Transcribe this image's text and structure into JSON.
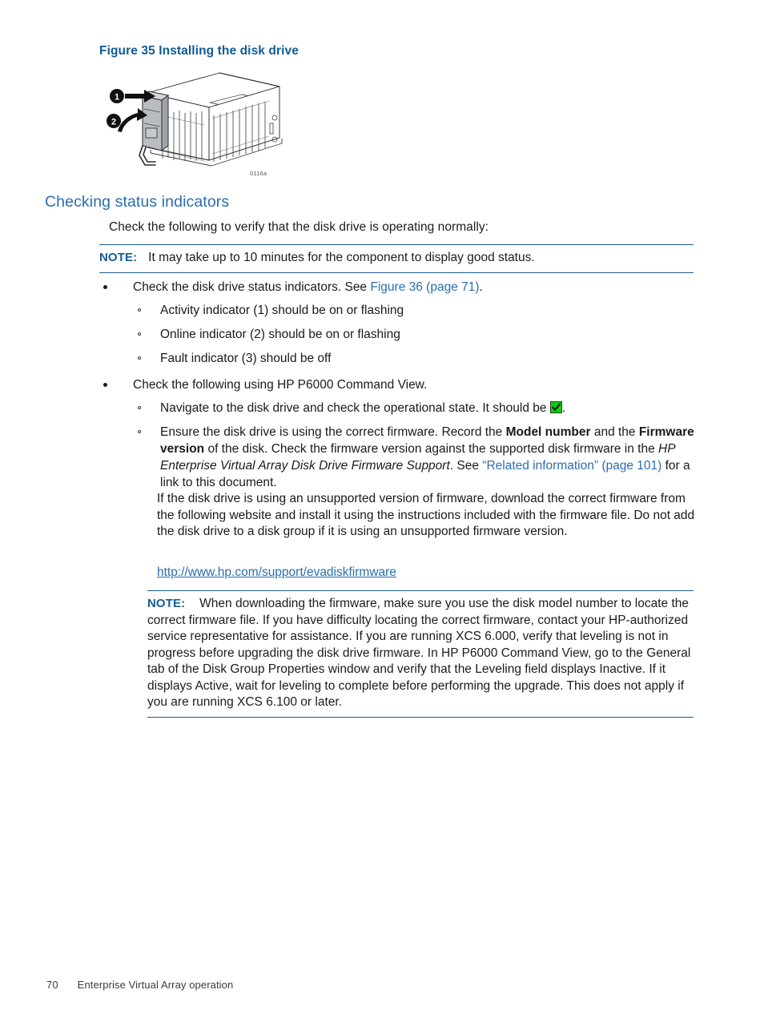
{
  "document": {
    "figure": {
      "title": "Figure 35 Installing the disk drive",
      "image_id": "0116a",
      "callouts": [
        "1",
        "2"
      ],
      "alt": "Isometric line drawing of a disk enclosure with a disk drive being inserted into the leftmost bay; arrow 1 points the drive into the bay, arrow 2 shows the latch handle rotating closed."
    },
    "section": {
      "heading": "Checking status indicators",
      "lead_paragraph": "Check the following to verify that the disk drive is operating normally:"
    },
    "note_1": {
      "label": "NOTE:",
      "text": "It may take up to 10 minutes for the component to display good status."
    },
    "bullets": [
      {
        "text_before_link": "Check the disk drive status indicators. See ",
        "link": "Figure 36 (page 71)",
        "text_after_link": ".",
        "sub_items": [
          "Activity indicator (1) should be on or flashing",
          "Online indicator (2) should be on or flashing",
          "Fault indicator (3) should be off"
        ]
      },
      {
        "text": "Check the following using HP P6000 Command View.",
        "sub_items": [
          "Navigate to the disk drive and check the operational state. It should be "
        ]
      }
    ],
    "check_icon": {
      "name": "green-check-status-icon",
      "color": "#00d400",
      "trailing_text": "."
    },
    "firmware_item": {
      "part1": "Ensure the disk drive is using the correct firmware. Record the ",
      "bold1": "Model number",
      "part2": " and the ",
      "bold2": "Firmware version",
      "part3": " of the disk. Check the firmware version against the supported disk firmware in the ",
      "italic1": "HP Enterprise Virtual Array Disk Drive Firmware Support",
      "part4": ". See ",
      "link1": "“Related information” (page 101)",
      "part5": " for a link to this document."
    },
    "unsupported_firmware_para": "If the disk drive is using an unsupported version of firmware, download the correct firmware from the following website and install it using the instructions included with the firmware file. Do not add the disk drive to a disk group if it is using an unsupported firmware version.",
    "url": "http://www.hp.com/support/evadiskfirmware",
    "note_2": {
      "label": "NOTE:",
      "text": "When downloading the firmware, make sure you use the disk model number to locate the correct firmware file. If you have difficulty locating the correct firmware, contact your HP-authorized service representative for assistance. If you are running XCS 6.000, verify that leveling is not in progress before upgrading the disk drive firmware. In HP P6000 Command View, go to the General tab of the Disk Group Properties window and verify that the Leveling field displays Inactive. If it displays Active, wait for leveling to complete before performing the upgrade. This does not apply if you are running XCS 6.100 or later."
    },
    "footer": {
      "page_number": "70",
      "chapter": "Enterprise Virtual Array operation"
    },
    "colors": {
      "heading_blue": "#2a6db0",
      "figure_title_blue": "#0f5b96",
      "note_rule_blue": "#1b5c92",
      "link_blue": "#2a6db0",
      "status_green": "#00d400"
    }
  }
}
